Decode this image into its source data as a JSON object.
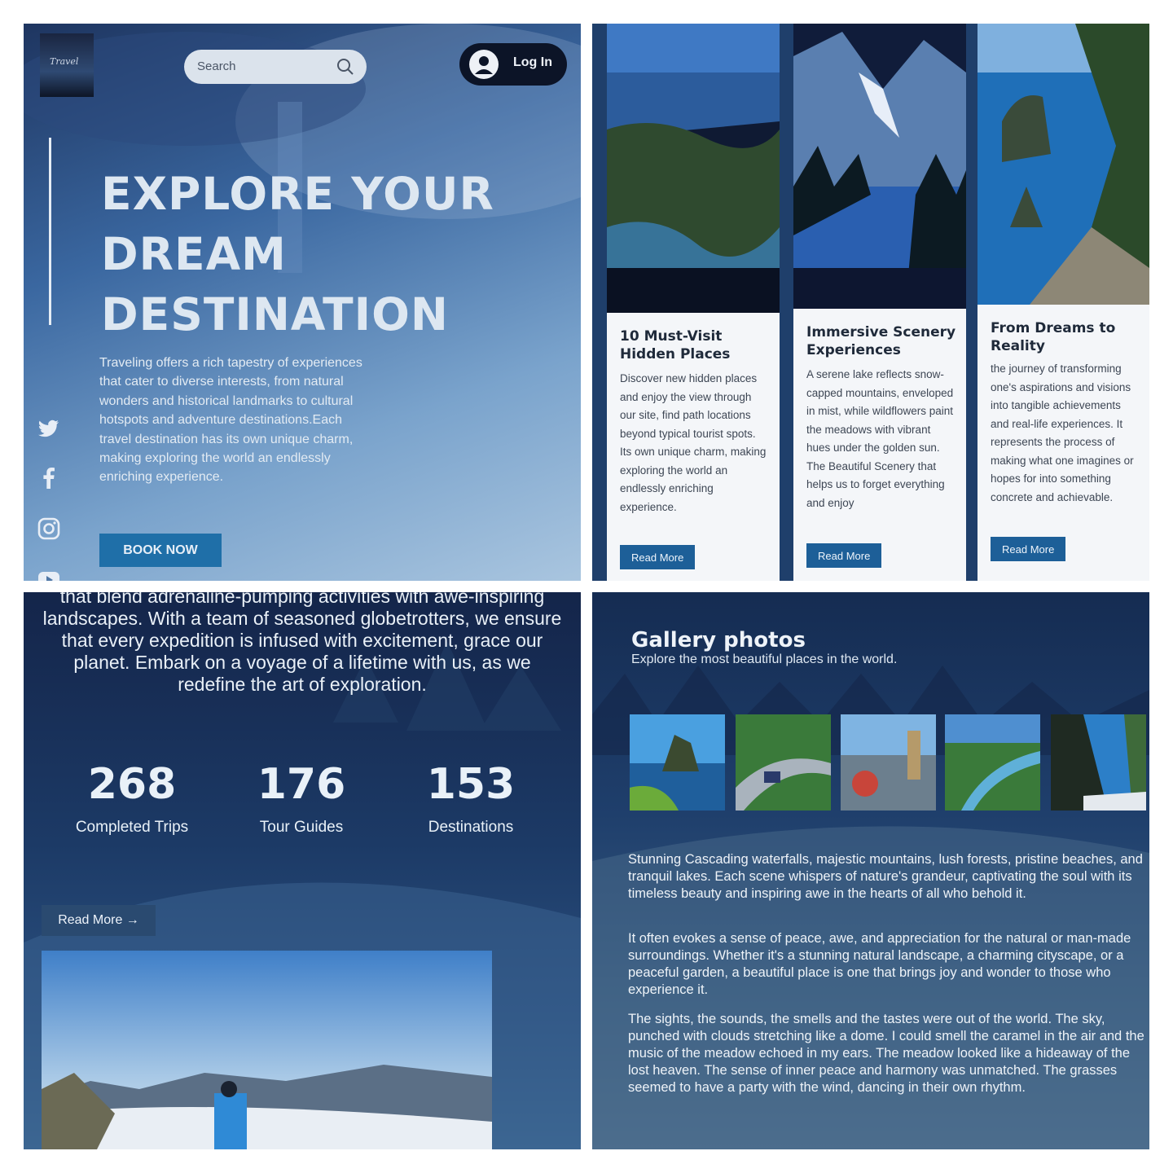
{
  "hero": {
    "logo_text": "Travel",
    "search_placeholder": "Search",
    "login_label": "Log In",
    "title_lines": [
      "EXPLORE YOUR",
      "DREAM",
      "DESTINATION"
    ],
    "description": "Traveling offers a rich tapestry of experiences that cater to diverse interests, from natural wonders and historical landmarks to cultural hotspots and adventure destinations.Each travel destination has its own unique charm, making exploring the world an endlessly enriching experience.",
    "cta_label": "BOOK NOW",
    "social_icons": [
      "twitter-icon",
      "facebook-icon",
      "instagram-icon",
      "youtube-icon"
    ]
  },
  "cards": [
    {
      "title": "10 Must-Visit Hidden Places",
      "text": "Discover new hidden places and enjoy the view through our site, find path locations beyond typical tourist spots. Its own unique charm, making exploring the world an endlessly enriching experience.",
      "button": "Read More"
    },
    {
      "title": "Immersive Scenery Experiences",
      "text": "A serene lake reflects snow-capped mountains, enveloped in mist, while wildflowers paint the meadows with vibrant hues under the golden sun. The Beautiful Scenery that helps us to forget everything and enjoy",
      "button": "Read More"
    },
    {
      "title": "From Dreams to Reality",
      "text": "the journey of transforming one's aspirations and visions into tangible achievements and real-life experiences. It represents the process of making what one imagines or hopes for into something concrete and achievable.",
      "button": "Read More"
    }
  ],
  "about": {
    "intro": "that blend adrenaline-pumping activities with awe-inspiring landscapes. With a team of seasoned globetrotters, we ensure that every expedition is infused with excitement, grace our planet. Embark on a voyage of a lifetime with us, as we redefine the art of exploration.",
    "stats": [
      {
        "value": "268",
        "label": "Completed Trips"
      },
      {
        "value": "176",
        "label": "Tour Guides"
      },
      {
        "value": "153",
        "label": "Destinations"
      }
    ],
    "read_more": "Read More →"
  },
  "gallery": {
    "title": "Gallery photos",
    "subtitle": "Explore the most beautiful places in the world.",
    "paragraphs": [
      "Stunning Cascading waterfalls, majestic mountains, lush forests, pristine beaches, and tranquil lakes. Each scene whispers of nature's grandeur, captivating the soul with its timeless beauty and inspiring awe in the hearts of all who behold it.",
      "It often evokes a sense of peace, awe, and appreciation for the natural or man-made surroundings. Whether it's a stunning natural landscape, a charming cityscape, or a peaceful garden, a beautiful place is one that brings joy and wonder to those who experience it.",
      "The sights, the sounds, the smells and the tastes were out of the world. The sky, punched with clouds stretching like a dome. I could smell the caramel in the air and the music of the meadow echoed in my ears. The meadow looked like a hideaway of the lost heaven. The sense of inner peace and harmony was unmatched. The grasses seemed to have a party with the wind, dancing in their own rhythm."
    ]
  }
}
